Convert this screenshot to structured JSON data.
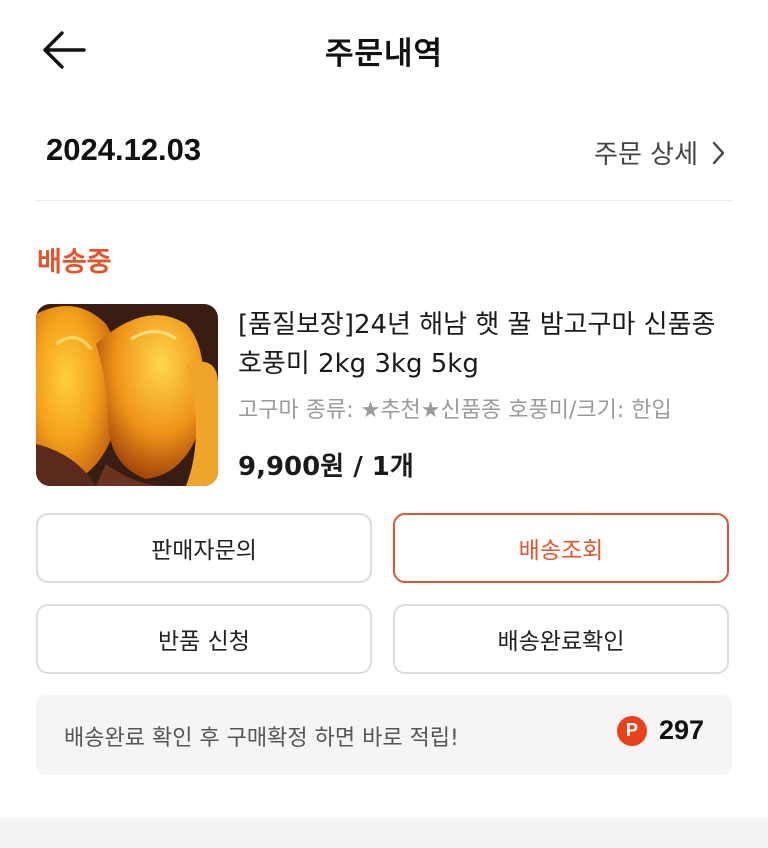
{
  "header": {
    "title": "주문내역"
  },
  "order": {
    "date": "2024.12.03",
    "detail_label": "주문 상세",
    "status": "배송중",
    "product": {
      "title": "[품질보장]24년 해남 햇 꿀 밤고구마 신품종 호풍미 2kg 3kg 5kg",
      "option": "고구마 종류: ★추천★신품종 호풍미/크기: 한입",
      "price": "9,900원 / 1개"
    }
  },
  "actions": {
    "seller_inquiry": "판매자문의",
    "track_delivery": "배송조회",
    "return_request": "반품 신청",
    "confirm_delivery": "배송완료확인"
  },
  "points": {
    "message": "배송완료 확인 후 구매확정 하면 바로 적립!",
    "badge": "P",
    "value": "297"
  },
  "colors": {
    "accent": "#e0552d",
    "point_badge": "#e8421a"
  }
}
